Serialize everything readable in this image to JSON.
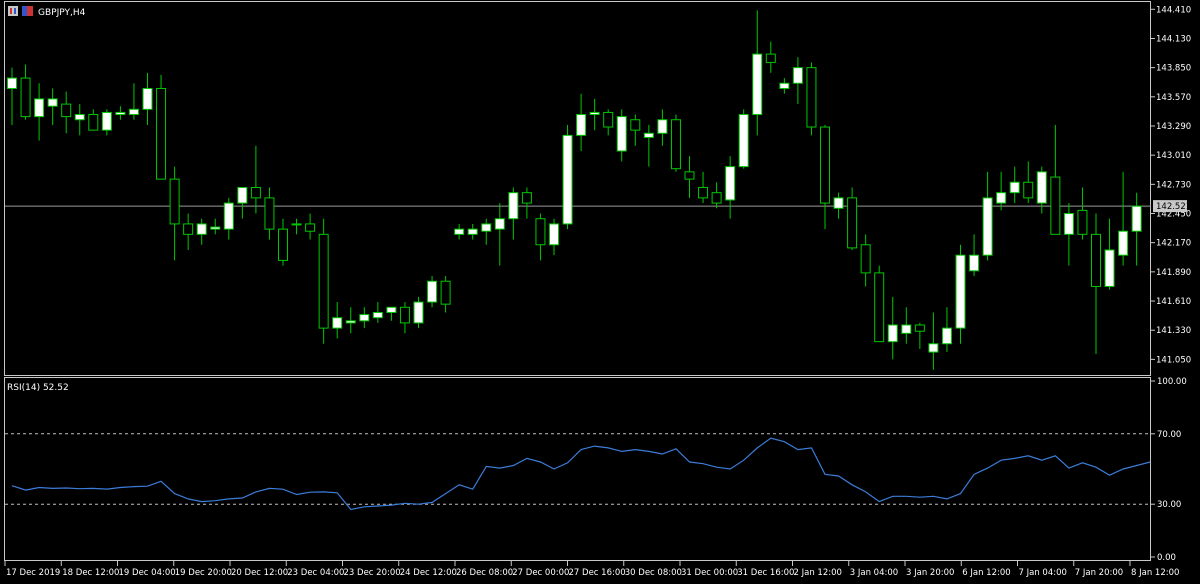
{
  "header": {
    "symbol": "GBPJPY,H4"
  },
  "rsi": {
    "label": "RSI(14) 52.52"
  },
  "colors": {
    "background": "#000000",
    "frame": "#c8c8c8",
    "bull_fill": "#ffffff",
    "bear_fill": "#000000",
    "wick": "#00c800",
    "rsi_line": "#3b7dd8",
    "level_line": "#c0c0c0",
    "price_line": "#9a9a9a",
    "price_tag_bg": "#c8c8c8",
    "price_tag_text": "#000000"
  },
  "chart_data": [
    {
      "type": "candlestick",
      "symbol": "GBPJPY",
      "timeframe": "H4",
      "ylim": [
        140.9,
        144.48
      ],
      "y_ticks": [
        "144.410",
        "144.130",
        "143.850",
        "143.570",
        "143.290",
        "143.010",
        "142.730",
        "142.450",
        "142.170",
        "141.890",
        "141.610",
        "141.330",
        "141.050"
      ],
      "current_price": "142.521",
      "x_ticks": [
        "17 Dec 2019",
        "18 Dec 12:00",
        "19 Dec 04:00",
        "19 Dec 20:00",
        "20 Dec 12:00",
        "23 Dec 04:00",
        "23 Dec 20:00",
        "24 Dec 12:00",
        "26 Dec 08:00",
        "27 Dec 00:00",
        "27 Dec 16:00",
        "30 Dec 08:00",
        "31 Dec 00:00",
        "31 Dec 16:00",
        "2 Jan 12:00",
        "3 Jan 04:00",
        "3 Jan 20:00",
        "6 Jan 12:00",
        "7 Jan 04:00",
        "7 Jan 20:00",
        "8 Jan 12:00"
      ],
      "ohlc": [
        [
          143.65,
          143.85,
          143.3,
          143.75
        ],
        [
          143.75,
          143.88,
          143.35,
          143.38
        ],
        [
          143.38,
          143.7,
          143.15,
          143.55
        ],
        [
          143.48,
          143.65,
          143.3,
          143.55
        ],
        [
          143.5,
          143.62,
          143.22,
          143.38
        ],
        [
          143.35,
          143.5,
          143.2,
          143.4
        ],
        [
          143.4,
          143.45,
          143.25,
          143.25
        ],
        [
          143.25,
          143.45,
          143.2,
          143.42
        ],
        [
          143.4,
          143.48,
          143.35,
          143.42
        ],
        [
          143.4,
          143.7,
          143.35,
          143.45
        ],
        [
          143.45,
          143.8,
          143.3,
          143.65
        ],
        [
          143.65,
          143.78,
          142.8,
          142.78
        ],
        [
          142.78,
          142.9,
          142.0,
          142.35
        ],
        [
          142.35,
          142.45,
          142.1,
          142.25
        ],
        [
          142.25,
          142.4,
          142.15,
          142.35
        ],
        [
          142.3,
          142.4,
          142.25,
          142.32
        ],
        [
          142.3,
          142.6,
          142.2,
          142.55
        ],
        [
          142.55,
          142.7,
          142.4,
          142.7
        ],
        [
          142.7,
          143.1,
          142.45,
          142.6
        ],
        [
          142.6,
          142.7,
          142.2,
          142.3
        ],
        [
          142.3,
          142.4,
          141.95,
          142.0
        ],
        [
          142.35,
          142.4,
          142.25,
          142.35
        ],
        [
          142.35,
          142.45,
          142.2,
          142.28
        ],
        [
          142.25,
          142.4,
          141.2,
          141.35
        ],
        [
          141.35,
          141.6,
          141.25,
          141.45
        ],
        [
          141.4,
          141.55,
          141.3,
          141.42
        ],
        [
          141.42,
          141.55,
          141.35,
          141.48
        ],
        [
          141.45,
          141.6,
          141.4,
          141.5
        ],
        [
          141.5,
          141.55,
          141.42,
          141.55
        ],
        [
          141.55,
          141.6,
          141.3,
          141.4
        ],
        [
          141.4,
          141.65,
          141.35,
          141.6
        ],
        [
          141.6,
          141.85,
          141.55,
          141.8
        ],
        [
          141.8,
          141.85,
          141.5,
          141.58
        ],
        [
          142.25,
          142.35,
          142.2,
          142.3
        ],
        [
          142.25,
          142.35,
          142.2,
          142.3
        ],
        [
          142.28,
          142.4,
          142.15,
          142.35
        ],
        [
          142.3,
          142.55,
          141.95,
          142.4
        ],
        [
          142.4,
          142.7,
          142.2,
          142.65
        ],
        [
          142.65,
          142.7,
          142.4,
          142.55
        ],
        [
          142.4,
          142.45,
          142.0,
          142.15
        ],
        [
          142.15,
          142.4,
          142.05,
          142.35
        ],
        [
          142.35,
          143.3,
          142.3,
          143.2
        ],
        [
          143.2,
          143.6,
          143.05,
          143.4
        ],
        [
          143.4,
          143.55,
          143.25,
          143.42
        ],
        [
          143.42,
          143.45,
          143.2,
          143.28
        ],
        [
          143.05,
          143.45,
          142.95,
          143.38
        ],
        [
          143.35,
          143.4,
          143.1,
          143.25
        ],
        [
          143.18,
          143.3,
          142.9,
          143.22
        ],
        [
          143.22,
          143.45,
          143.1,
          143.35
        ],
        [
          143.35,
          143.4,
          142.85,
          142.88
        ],
        [
          142.85,
          143.0,
          142.6,
          142.78
        ],
        [
          142.7,
          142.85,
          142.55,
          142.6
        ],
        [
          142.65,
          142.75,
          142.5,
          142.55
        ],
        [
          142.58,
          143.0,
          142.4,
          142.9
        ],
        [
          142.9,
          143.45,
          142.88,
          143.4
        ],
        [
          143.4,
          144.4,
          143.2,
          143.98
        ],
        [
          143.98,
          144.1,
          143.8,
          143.9
        ],
        [
          143.65,
          143.75,
          143.6,
          143.7
        ],
        [
          143.7,
          143.95,
          143.5,
          143.85
        ],
        [
          143.85,
          143.9,
          143.2,
          143.28
        ],
        [
          143.28,
          143.3,
          142.3,
          142.55
        ],
        [
          142.5,
          142.65,
          142.4,
          142.6
        ],
        [
          142.6,
          142.7,
          142.1,
          142.12
        ],
        [
          142.15,
          142.25,
          141.75,
          141.88
        ],
        [
          141.88,
          141.95,
          141.22,
          141.22
        ],
        [
          141.22,
          141.65,
          141.05,
          141.38
        ],
        [
          141.3,
          141.55,
          141.2,
          141.38
        ],
        [
          141.38,
          141.4,
          141.15,
          141.32
        ],
        [
          141.12,
          141.5,
          140.95,
          141.2
        ],
        [
          141.2,
          141.55,
          141.12,
          141.35
        ],
        [
          141.35,
          142.15,
          141.2,
          142.05
        ],
        [
          141.9,
          142.25,
          141.85,
          142.05
        ],
        [
          142.05,
          142.85,
          142.0,
          142.6
        ],
        [
          142.55,
          142.85,
          142.48,
          142.65
        ],
        [
          142.65,
          142.9,
          142.55,
          142.75
        ],
        [
          142.75,
          142.95,
          142.55,
          142.6
        ],
        [
          142.55,
          142.9,
          142.45,
          142.85
        ],
        [
          142.8,
          143.3,
          142.3,
          142.25
        ],
        [
          142.25,
          142.55,
          141.95,
          142.45
        ],
        [
          142.48,
          142.7,
          142.2,
          142.25
        ],
        [
          142.25,
          142.45,
          141.1,
          141.75
        ],
        [
          141.75,
          142.4,
          141.72,
          142.1
        ],
        [
          142.05,
          142.85,
          141.95,
          142.28
        ],
        [
          142.28,
          142.65,
          141.95,
          142.52
        ]
      ]
    },
    {
      "type": "line",
      "name": "RSI(14)",
      "ylim": [
        0,
        100
      ],
      "y_ticks": [
        "100.00",
        "70.00",
        "30.00",
        "0.00"
      ],
      "levels": [
        70,
        30
      ],
      "values": [
        40.5,
        38.0,
        39.5,
        39.0,
        39.2,
        38.8,
        39.0,
        38.6,
        39.5,
        40.0,
        40.2,
        43.0,
        36.0,
        33.0,
        31.5,
        32.0,
        33.0,
        33.5,
        37.0,
        39.0,
        38.5,
        35.5,
        36.8,
        37.0,
        36.5,
        27.0,
        28.5,
        29.0,
        29.5,
        30.5,
        30.0,
        31.0,
        36.0,
        41.0,
        38.5,
        51.5,
        50.5,
        52.0,
        56.0,
        54.0,
        50.0,
        53.5,
        61.0,
        63.0,
        62.0,
        60.0,
        61.0,
        60.0,
        58.5,
        61.5,
        54.0,
        53.0,
        51.0,
        50.0,
        55.0,
        62.0,
        67.5,
        65.5,
        61.0,
        62.0,
        47.0,
        46.0,
        41.0,
        37.0,
        31.5,
        34.5,
        34.5,
        34.0,
        34.5,
        33.0,
        36.0,
        47.0,
        50.5,
        55.0,
        56.0,
        57.5,
        55.0,
        57.5,
        50.5,
        53.5,
        51.0,
        46.5,
        50.0,
        52.0,
        54.0
      ]
    }
  ]
}
